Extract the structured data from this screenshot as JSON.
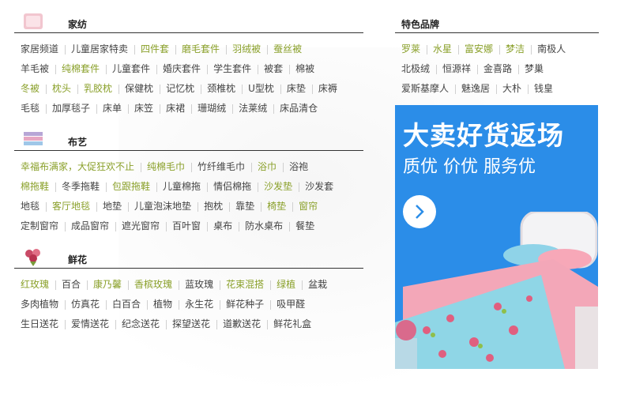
{
  "sections": [
    {
      "title": "家纺",
      "rows": [
        [
          {
            "t": "家居频道",
            "h": false
          },
          {
            "t": "儿童居家特卖",
            "h": false
          },
          {
            "t": "四件套",
            "h": true
          },
          {
            "t": "磨毛套件",
            "h": true
          },
          {
            "t": "羽绒被",
            "h": true
          },
          {
            "t": "蚕丝被",
            "h": true
          }
        ],
        [
          {
            "t": "羊毛被",
            "h": false
          },
          {
            "t": "纯棉套件",
            "h": true
          },
          {
            "t": "儿童套件",
            "h": false
          },
          {
            "t": "婚庆套件",
            "h": false
          },
          {
            "t": "学生套件",
            "h": false
          },
          {
            "t": "被套",
            "h": false
          },
          {
            "t": "棉被",
            "h": false
          }
        ],
        [
          {
            "t": "冬被",
            "h": true
          },
          {
            "t": "枕头",
            "h": true
          },
          {
            "t": "乳胶枕",
            "h": true
          },
          {
            "t": "保健枕",
            "h": false
          },
          {
            "t": "记忆枕",
            "h": false
          },
          {
            "t": "颈椎枕",
            "h": false
          },
          {
            "t": "U型枕",
            "h": false
          },
          {
            "t": "床垫",
            "h": false
          },
          {
            "t": "床褥",
            "h": false
          }
        ],
        [
          {
            "t": "毛毯",
            "h": false
          },
          {
            "t": "加厚毯子",
            "h": false
          },
          {
            "t": "床单",
            "h": false
          },
          {
            "t": "床笠",
            "h": false
          },
          {
            "t": "床裙",
            "h": false
          },
          {
            "t": "珊瑚绒",
            "h": false
          },
          {
            "t": "法莱绒",
            "h": false
          },
          {
            "t": "床品清仓",
            "h": false
          }
        ]
      ]
    },
    {
      "title": "布艺",
      "rows": [
        [
          {
            "t": "幸福布满家，大促狂欢不止",
            "h": true
          },
          {
            "t": "纯棉毛巾",
            "h": true
          },
          {
            "t": "竹纤维毛巾",
            "h": false
          },
          {
            "t": "浴巾",
            "h": true
          },
          {
            "t": "浴袍",
            "h": false
          }
        ],
        [
          {
            "t": "棉拖鞋",
            "h": true
          },
          {
            "t": "冬季拖鞋",
            "h": false
          },
          {
            "t": "包跟拖鞋",
            "h": true
          },
          {
            "t": "儿童棉拖",
            "h": false
          },
          {
            "t": "情侣棉拖",
            "h": false
          },
          {
            "t": "沙发垫",
            "h": true
          },
          {
            "t": "沙发套",
            "h": false
          }
        ],
        [
          {
            "t": "地毯",
            "h": false
          },
          {
            "t": "客厅地毯",
            "h": true
          },
          {
            "t": "地垫",
            "h": false
          },
          {
            "t": "儿童泡沫地垫",
            "h": false
          },
          {
            "t": "抱枕",
            "h": false
          },
          {
            "t": "靠垫",
            "h": false
          },
          {
            "t": "椅垫",
            "h": true
          },
          {
            "t": "窗帘",
            "h": true
          }
        ],
        [
          {
            "t": "定制窗帘",
            "h": false
          },
          {
            "t": "成品窗帘",
            "h": false
          },
          {
            "t": "遮光窗帘",
            "h": false
          },
          {
            "t": "百叶窗",
            "h": false
          },
          {
            "t": "桌布",
            "h": false
          },
          {
            "t": "防水桌布",
            "h": false
          },
          {
            "t": "餐垫",
            "h": false
          }
        ]
      ]
    },
    {
      "title": "鲜花",
      "rows": [
        [
          {
            "t": "红玫瑰",
            "h": true
          },
          {
            "t": "百合",
            "h": false
          },
          {
            "t": "康乃馨",
            "h": true
          },
          {
            "t": "香槟玫瑰",
            "h": true
          },
          {
            "t": "蓝玫瑰",
            "h": false
          },
          {
            "t": "花束混搭",
            "h": true
          },
          {
            "t": "绿植",
            "h": true
          },
          {
            "t": "盆栽",
            "h": false
          }
        ],
        [
          {
            "t": "多肉植物",
            "h": false
          },
          {
            "t": "仿真花",
            "h": false
          },
          {
            "t": "白百合",
            "h": false
          },
          {
            "t": "植物",
            "h": false
          },
          {
            "t": "永生花",
            "h": false
          },
          {
            "t": "鲜花种子",
            "h": false
          },
          {
            "t": "吸甲醛",
            "h": false
          }
        ],
        [
          {
            "t": "生日送花",
            "h": false
          },
          {
            "t": "爱情送花",
            "h": false
          },
          {
            "t": "纪念送花",
            "h": false
          },
          {
            "t": "探望送花",
            "h": false
          },
          {
            "t": "道歉送花",
            "h": false
          },
          {
            "t": "鲜花礼盒",
            "h": false
          }
        ]
      ]
    }
  ],
  "brands": {
    "title": "特色品牌",
    "rows": [
      [
        {
          "t": "罗莱",
          "h": true
        },
        {
          "t": "水星",
          "h": true
        },
        {
          "t": "富安娜",
          "h": true
        },
        {
          "t": "梦洁",
          "h": true
        },
        {
          "t": "南极人",
          "h": false
        }
      ],
      [
        {
          "t": "北极绒",
          "h": false
        },
        {
          "t": "恒源祥",
          "h": false
        },
        {
          "t": "金喜路",
          "h": false
        },
        {
          "t": "梦巢",
          "h": false
        }
      ],
      [
        {
          "t": "爱斯基摩人",
          "h": false
        },
        {
          "t": "魅逸居",
          "h": false
        },
        {
          "t": "大朴",
          "h": false
        },
        {
          "t": "钱皇",
          "h": false
        }
      ]
    ]
  },
  "banner": {
    "title": "大卖好货返场",
    "subtitle": "质优 价优 服务优",
    "arrow_icon": "chevron-right-icon",
    "bg_color": "#2b8de8"
  },
  "colors": {
    "highlight": "#8aa02a",
    "normal": "#444444"
  }
}
